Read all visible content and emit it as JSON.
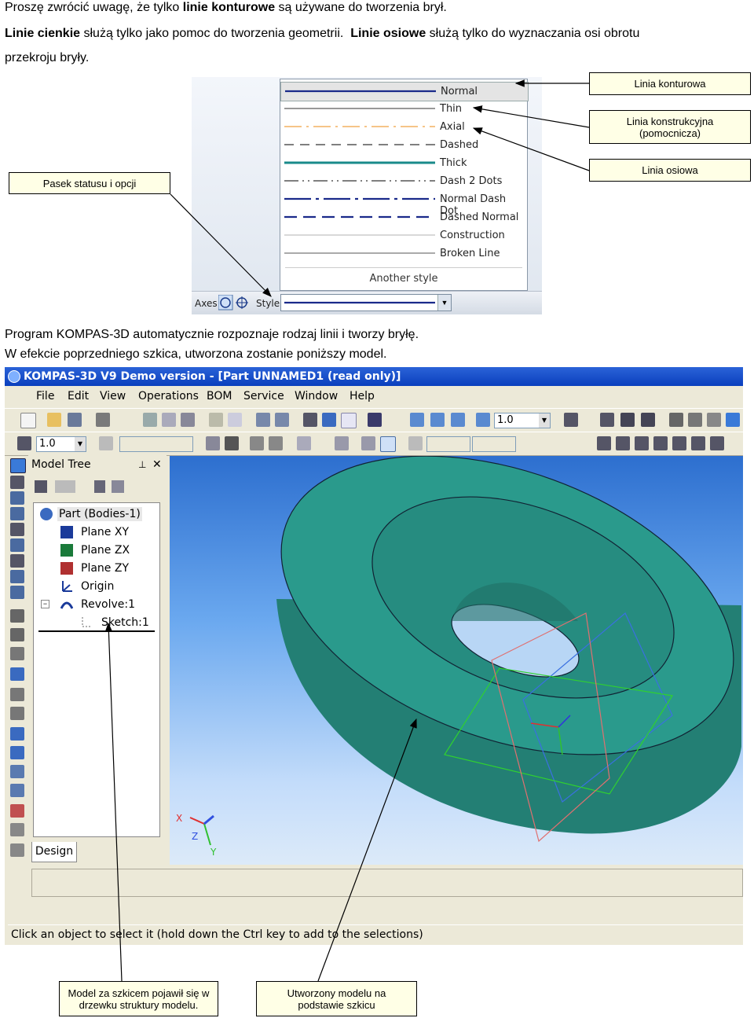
{
  "intro": {
    "line1_prefix": "Proszę zwrócić uwagę, że tylko ",
    "line1_bold": "linie konturowe",
    "line1_suffix": " są używane do tworzenia brył.",
    "line2_bold1": "Linie cienkie",
    "line2_mid": " służą tylko jako pomoc do tworzenia geometrii.  ",
    "line2_bold2": "Linie osiowe",
    "line2_suffix": " służą tylko do wyznaczania osi obrotu",
    "line3": "przekroju bryły."
  },
  "callouts": {
    "contour": "Linia konturowa",
    "construction": "Linia konstrukcyjna (pomocnicza)",
    "axial": "Linia osiowa",
    "status_bar": "Pasek statusu i opcji",
    "model_tree": "Model za szkicem pojawił się w drzewku struktury modelu.",
    "created": "Utworzony modelu na podstawie szkicu"
  },
  "style_menu": {
    "items": [
      "Normal",
      "Thin",
      "Axial",
      "Dashed",
      "Thick",
      "Dash 2 Dots",
      "Normal Dash Dot",
      "Dashed Normal",
      "Construction",
      "Broken Line"
    ],
    "another": "Another style"
  },
  "status_bar": {
    "axes_label": "Axes",
    "style_label": "Style"
  },
  "middle": {
    "line1": "Program KOMPAS-3D automatycznie rozpoznaje rodzaj linii i tworzy bryłę.",
    "line2": "W efekcie poprzedniego szkica, utworzona zostanie poniższy model."
  },
  "kompas": {
    "title": "KOMPAS-3D V9 Demo version - [Part UNNAMED1 (read only)]",
    "menu": [
      "File",
      "Edit",
      "View",
      "Operations",
      "BOM",
      "Service",
      "Window",
      "Help"
    ],
    "zoom_value": "1.0",
    "step_value": "1.0",
    "tree_title": "Model Tree",
    "tree_nodes": [
      "Part (Bodies-1)",
      "Plane XY",
      "Plane ZX",
      "Plane ZY",
      "Origin",
      "Revolve:1",
      "Sketch:1"
    ],
    "design_tab": "Design",
    "status_text": "Click an object to select it (hold down the Ctrl key to add to the selections)",
    "axis_x": "X",
    "axis_y": "Y",
    "axis_z": "Z"
  },
  "colors": {
    "model_teal": "#2a9a8c",
    "normal_line": "#1a2a8a",
    "axial_line": "#f0a040",
    "thick_line": "#1a8a8a"
  }
}
